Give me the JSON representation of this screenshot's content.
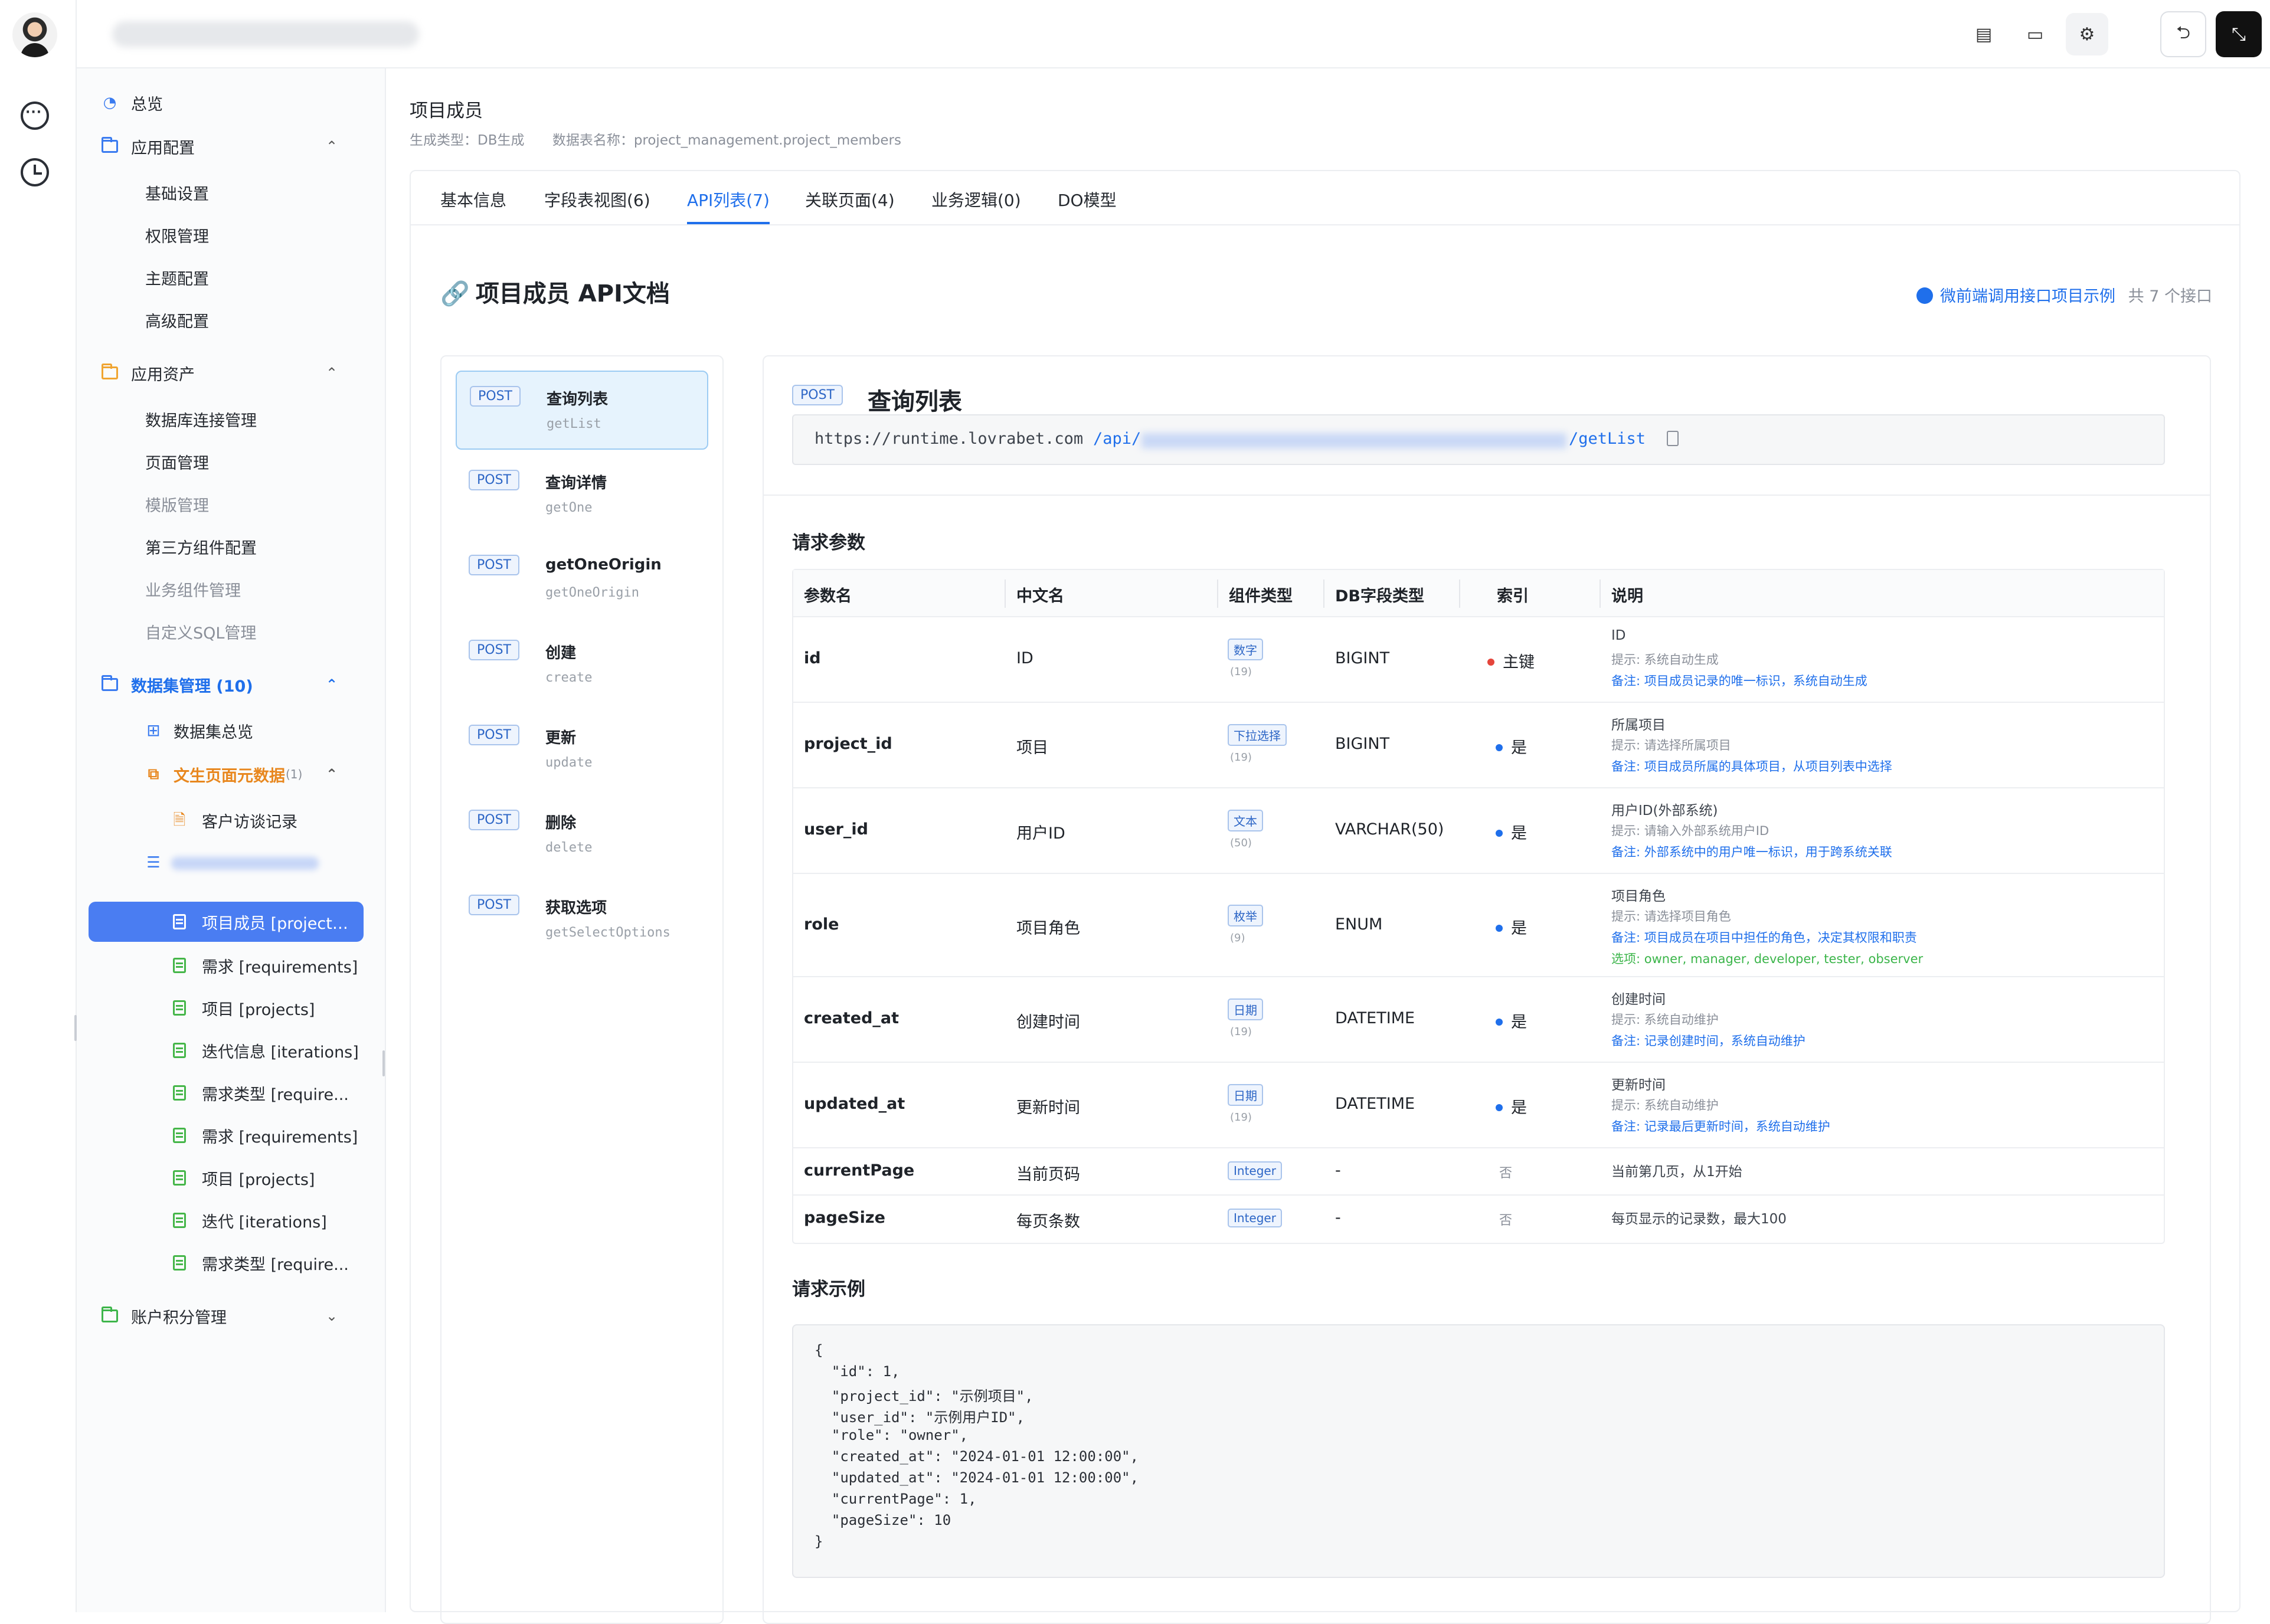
{
  "topbar": {
    "icons": [
      "document-icon",
      "monitor-icon",
      "gear-icon",
      "exit-icon",
      "fullscreen-icon"
    ]
  },
  "sidebar": {
    "items": [
      {
        "label": "总览",
        "icon": "dashboard-icon"
      },
      {
        "label": "应用配置",
        "icon": "folder-icon"
      },
      {
        "label": "基础设置"
      },
      {
        "label": "权限管理"
      },
      {
        "label": "主题配置"
      },
      {
        "label": "高级配置"
      },
      {
        "label": "应用资产",
        "icon": "folder-icon"
      },
      {
        "label": "数据库连接管理"
      },
      {
        "label": "页面管理"
      },
      {
        "label": "模版管理"
      },
      {
        "label": "第三方组件配置"
      },
      {
        "label": "业务组件管理"
      },
      {
        "label": "自定义SQL管理"
      },
      {
        "label": "数据集管理 (10)",
        "icon": "folder-icon"
      },
      {
        "label": "数据集总览",
        "icon": "grid-icon"
      },
      {
        "label": "文生页面元数据",
        "count": "(1)",
        "icon": "copy-icon"
      },
      {
        "label": "客户访谈记录",
        "icon": "file-icon"
      },
      {
        "label": "项目成员 [project_...",
        "icon": "table-icon"
      },
      {
        "label": "需求 [requirements]",
        "icon": "table-icon"
      },
      {
        "label": "项目 [projects]",
        "icon": "table-icon"
      },
      {
        "label": "迭代信息 [iterations]",
        "icon": "table-icon"
      },
      {
        "label": "需求类型 [require...",
        "icon": "table-icon"
      },
      {
        "label": "需求 [requirements]",
        "icon": "table-icon"
      },
      {
        "label": "项目 [projects]",
        "icon": "table-icon"
      },
      {
        "label": "迭代 [iterations]",
        "icon": "table-icon"
      },
      {
        "label": "需求类型 [require...",
        "icon": "table-icon"
      },
      {
        "label": "账户积分管理",
        "icon": "folder-icon"
      }
    ]
  },
  "page": {
    "title": "项目成员",
    "gen_type": "生成类型：DB生成",
    "table_name": "数据表名称：project_management.project_members"
  },
  "tabs": [
    "基本信息",
    "字段表视图(6)",
    "API列表(7)",
    "关联页面(4)",
    "业务逻辑(0)",
    "DO模型"
  ],
  "doc": {
    "title": "项目成员 API文档",
    "example_link": "微前端调用接口项目示例",
    "count": "共 7 个接口"
  },
  "apis": [
    {
      "method": "POST",
      "name": "查询列表",
      "code": "getList"
    },
    {
      "method": "POST",
      "name": "查询详情",
      "code": "getOne"
    },
    {
      "method": "POST",
      "name": "getOneOrigin",
      "code": "getOneOrigin"
    },
    {
      "method": "POST",
      "name": "创建",
      "code": "create"
    },
    {
      "method": "POST",
      "name": "更新",
      "code": "update"
    },
    {
      "method": "POST",
      "name": "删除",
      "code": "delete"
    },
    {
      "method": "POST",
      "name": "获取选项",
      "code": "getSelectOptions"
    }
  ],
  "detail": {
    "method": "POST",
    "title": "查询列表",
    "url_base": "https://runtime.lovrabet.com",
    "url_prefix": "/api/",
    "url_suffix": "/getList",
    "params_title": "请求参数",
    "example_title": "请求示例"
  },
  "params": {
    "headers": [
      "参数名",
      "中文名",
      "组件类型",
      "DB字段类型",
      "索引",
      "说明"
    ],
    "rows": [
      {
        "name": "id",
        "cn": "ID",
        "ctype": "数字",
        "len": "(19)",
        "db": "BIGINT",
        "index": "主键",
        "index_color": "#e5453b",
        "desc": "ID",
        "hint": "提示: 系统自动生成",
        "note": "备注: 项目成员记录的唯一标识，系统自动生成",
        "opt": ""
      },
      {
        "name": "project_id",
        "cn": "项目",
        "ctype": "下拉选择",
        "len": "(19)",
        "db": "BIGINT",
        "index": "是",
        "index_color": "#1f6feb",
        "desc": "所属项目",
        "hint": "提示: 请选择所属项目",
        "note": "备注: 项目成员所属的具体项目，从项目列表中选择",
        "opt": ""
      },
      {
        "name": "user_id",
        "cn": "用户ID",
        "ctype": "文本",
        "len": "(50)",
        "db": "VARCHAR(50)",
        "index": "是",
        "index_color": "#1f6feb",
        "desc": "用户ID(外部系统)",
        "hint": "提示: 请输入外部系统用户ID",
        "note": "备注: 外部系统中的用户唯一标识，用于跨系统关联",
        "opt": ""
      },
      {
        "name": "role",
        "cn": "项目角色",
        "ctype": "枚举",
        "len": "(9)",
        "db": "ENUM",
        "index": "是",
        "index_color": "#1f6feb",
        "desc": "项目角色",
        "hint": "提示: 请选择项目角色",
        "note": "备注: 项目成员在项目中担任的角色，决定其权限和职责",
        "opt": "选项: owner, manager, developer, tester, observer"
      },
      {
        "name": "created_at",
        "cn": "创建时间",
        "ctype": "日期",
        "len": "(19)",
        "db": "DATETIME",
        "index": "是",
        "index_color": "#1f6feb",
        "desc": "创建时间",
        "hint": "提示: 系统自动维护",
        "note": "备注: 记录创建时间，系统自动维护",
        "opt": ""
      },
      {
        "name": "updated_at",
        "cn": "更新时间",
        "ctype": "日期",
        "len": "(19)",
        "db": "DATETIME",
        "index": "是",
        "index_color": "#1f6feb",
        "desc": "更新时间",
        "hint": "提示: 系统自动维护",
        "note": "备注: 记录最后更新时间，系统自动维护",
        "opt": ""
      },
      {
        "name": "currentPage",
        "cn": "当前页码",
        "ctype": "Integer",
        "len": "",
        "db": "-",
        "index": "否",
        "index_color": "",
        "desc": "当前第几页，从1开始",
        "hint": "",
        "note": "",
        "opt": ""
      },
      {
        "name": "pageSize",
        "cn": "每页条数",
        "ctype": "Integer",
        "len": "",
        "db": "-",
        "index": "否",
        "index_color": "",
        "desc": "每页显示的记录数，最大100",
        "hint": "",
        "note": "",
        "opt": ""
      }
    ]
  },
  "example_code": [
    "{",
    "  \"id\": 1,",
    "  \"project_id\": \"示例项目\",",
    "  \"user_id\": \"示例用户ID\",",
    "  \"role\": \"owner\",",
    "  \"created_at\": \"2024-01-01 12:00:00\",",
    "  \"updated_at\": \"2024-01-01 12:00:00\",",
    "  \"currentPage\": 1,",
    "  \"pageSize\": 10",
    "}"
  ]
}
